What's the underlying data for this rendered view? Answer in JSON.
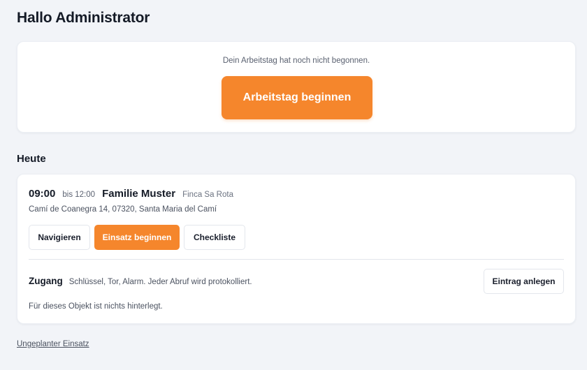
{
  "header": {
    "greeting": "Hallo Administrator"
  },
  "workday": {
    "status": "Dein Arbeitstag hat noch nicht begonnen.",
    "start_label": "Arbeitstag beginnen",
    "accent": "#f5862c"
  },
  "today": {
    "title": "Heute",
    "appointment": {
      "time": "09:00",
      "until": "bis 12:00",
      "client": "Familie Muster",
      "property": "Finca Sa Rota",
      "address": "Camí de Coanegra 14, 07320, Santa Maria del Camí",
      "actions": {
        "navigate": "Navigieren",
        "start": "Einsatz beginnen",
        "checklist": "Checkliste"
      }
    },
    "access": {
      "title": "Zugang",
      "description": "Schlüssel, Tor, Alarm. Jeder Abruf wird protokolliert.",
      "add_entry": "Eintrag anlegen",
      "empty": "Für dieses Objekt ist nichts hinterlegt."
    }
  },
  "footer": {
    "unplanned_link": "Ungeplanter Einsatz"
  }
}
